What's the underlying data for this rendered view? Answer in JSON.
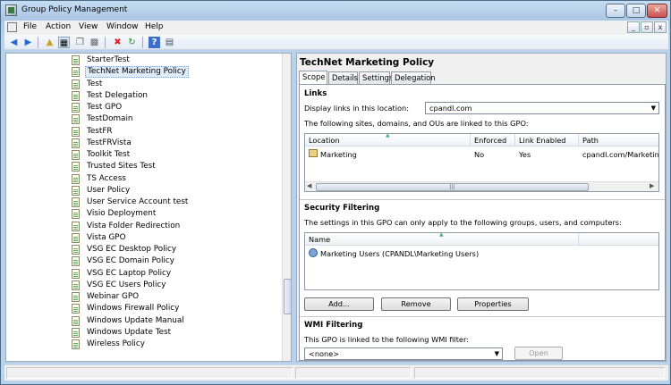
{
  "window": {
    "title": "Group Policy Management",
    "min": "–",
    "max": "□",
    "close": "✕"
  },
  "menu": {
    "items": [
      "File",
      "Action",
      "View",
      "Window",
      "Help"
    ],
    "mdi_min": "_",
    "mdi_restore": "▫",
    "mdi_close": "x"
  },
  "toolbar": {
    "icons": [
      "back-icon",
      "forward-icon",
      "up-folder-icon",
      "show-hide-tree-icon",
      "copy-icon",
      "paste-icon",
      "delete-icon",
      "refresh-icon",
      "help-icon",
      "properties-icon"
    ]
  },
  "tree": {
    "items": [
      "StarterTest",
      "TechNet Marketing Policy",
      "Test",
      "Test Delegation",
      "Test GPO",
      "TestDomain",
      "TestFR",
      "TestFRVista",
      "Toolkit Test",
      "Trusted Sites Test",
      "TS Access",
      "User Policy",
      "User Service Account test",
      "Visio Deployment",
      "Vista Folder Redirection",
      "Vista GPO",
      "VSG EC Desktop Policy",
      "VSG EC Domain Policy",
      "VSG EC Laptop Policy",
      "VSG EC Users Policy",
      "Webinar GPO",
      "Windows Firewall Policy",
      "Windows Update Manual",
      "Windows Update Test",
      "Wireless Policy"
    ],
    "selected": "TechNet Marketing Policy"
  },
  "details": {
    "title": "TechNet Marketing Policy",
    "tabs": [
      "Scope",
      "Details",
      "Settings",
      "Delegation"
    ],
    "links": {
      "heading": "Links",
      "display_label": "Display links in this location:",
      "location_value": "cpandl.com",
      "desc": "The following sites, domains, and OUs are linked to this GPO:",
      "columns": [
        "Location",
        "Enforced",
        "Link Enabled",
        "Path"
      ],
      "rows": [
        {
          "location": "Marketing",
          "enforced": "No",
          "link_enabled": "Yes",
          "path": "cpandl.com/Marketing"
        }
      ]
    },
    "security": {
      "heading": "Security Filtering",
      "desc": "The settings in this GPO can only apply to the following groups, users, and computers:",
      "column": "Name",
      "rows": [
        "Marketing Users (CPANDL\\Marketing Users)"
      ],
      "buttons": {
        "add": "Add...",
        "remove": "Remove",
        "properties": "Properties"
      }
    },
    "wmi": {
      "heading": "WMI Filtering",
      "desc": "This GPO is linked to the following WMI filter:",
      "filter_value": "<none>",
      "open": "Open"
    }
  }
}
